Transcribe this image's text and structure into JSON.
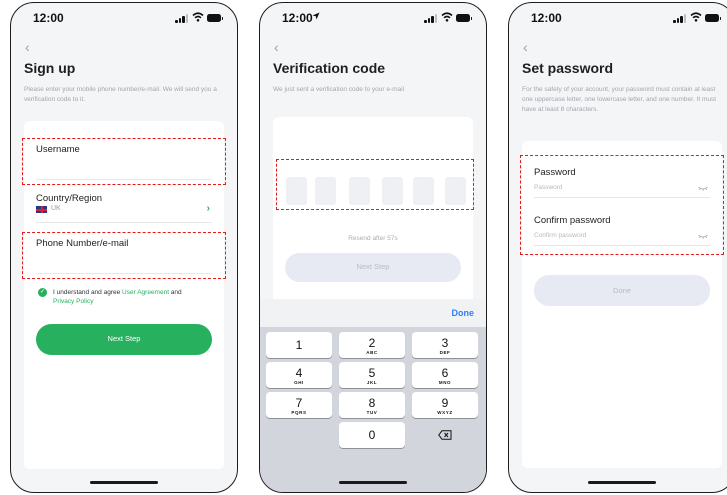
{
  "status_bar": {
    "time": "12:00"
  },
  "signup": {
    "back_icon": "chevron-left-icon",
    "title": "Sign up",
    "description": "Please enter your mobile phone number/e-mail. We will send you a verification code to it.",
    "username_label": "Username",
    "country_label": "Country/Region",
    "country_value": "UK",
    "phone_label": "Phone Number/e-mail",
    "agree_prefix": "I understand and agree ",
    "user_agreement": "User Agreement",
    "agree_and": " and",
    "privacy_policy": "Privacy Policy",
    "next_button": "Next Step",
    "accent_color": "#27b15f"
  },
  "verification": {
    "title": "Verification code",
    "description": "We just sent a verification code to your e-mail",
    "resend_text": "Resend after 57s",
    "next_button": "Next Step",
    "keyboard_done": "Done",
    "keys": [
      {
        "digit": "1",
        "letters": ""
      },
      {
        "digit": "2",
        "letters": "ABC"
      },
      {
        "digit": "3",
        "letters": "DEF"
      },
      {
        "digit": "4",
        "letters": "GHI"
      },
      {
        "digit": "5",
        "letters": "JKL"
      },
      {
        "digit": "6",
        "letters": "MNO"
      },
      {
        "digit": "7",
        "letters": "PQRS"
      },
      {
        "digit": "8",
        "letters": "TUV"
      },
      {
        "digit": "9",
        "letters": "WXYZ"
      },
      {
        "digit": "0",
        "letters": ""
      }
    ],
    "delete_icon": "backspace-icon"
  },
  "set_password": {
    "title": "Set password",
    "description": "For the safety of your account, your password must contain at least one uppercase letter, one lowercase letter, and one number. It must have at least 8 characters.",
    "password_label": "Password",
    "password_placeholder": "Password",
    "confirm_label": "Confirm password",
    "confirm_placeholder": "Confirm password",
    "done_button": "Done",
    "eye_icon": "eye-closed-icon"
  }
}
